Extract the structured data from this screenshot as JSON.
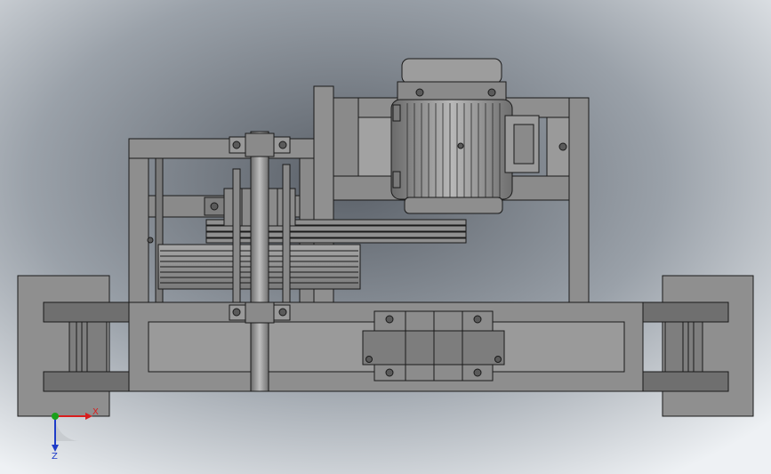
{
  "viewport": {
    "background_inner": "#5a6068",
    "background_outer": "#eef1f4"
  },
  "colors": {
    "steel": "#8e8e8e",
    "steel_light": "#b4b4b4",
    "steel_dark": "#6b6b6b",
    "outline": "#1a1a1a",
    "axis_x": "#d81e1e",
    "axis_y": "#1aa01a",
    "axis_z": "#1e3cc8"
  },
  "triad": {
    "x_label": "X",
    "z_label": "Z"
  }
}
